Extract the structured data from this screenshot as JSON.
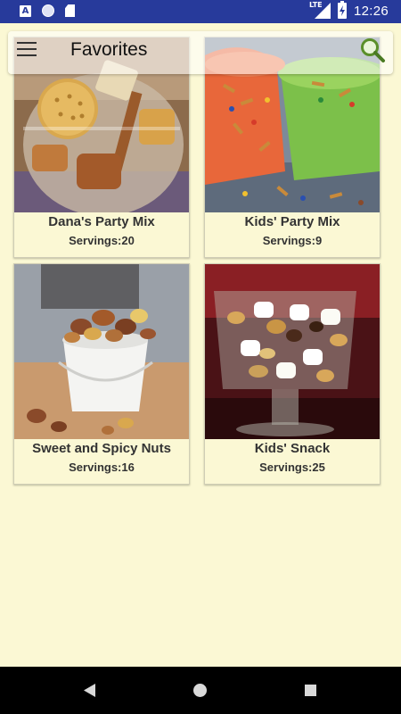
{
  "status_bar": {
    "time": "12:26",
    "network": "LTE",
    "icons": [
      "a-notification-icon",
      "circle-notification-icon",
      "sd-card-icon",
      "signal-icon",
      "battery-charging-icon"
    ]
  },
  "toolbar": {
    "title": "Favorites",
    "menu_icon": "hamburger-menu-icon",
    "search_icon": "search-icon"
  },
  "servings_label": "Servings:",
  "recipes": [
    {
      "title": "Dana's Party Mix",
      "servings": "20",
      "image": "party-mix-jar-photo"
    },
    {
      "title": "Kids' Party Mix",
      "servings": "9",
      "image": "party-mix-buckets-photo"
    },
    {
      "title": "Sweet and Spicy Nuts",
      "servings": "16",
      "image": "nuts-pail-photo"
    },
    {
      "title": "Kids' Snack",
      "servings": "25",
      "image": "snack-glass-photo"
    }
  ],
  "colors": {
    "status_bar": "#273A9B",
    "background": "#FBF8D4",
    "nav_bar": "#000000"
  },
  "nav": {
    "back_icon": "back-triangle-icon",
    "home_icon": "home-circle-icon",
    "recents_icon": "recents-square-icon"
  }
}
